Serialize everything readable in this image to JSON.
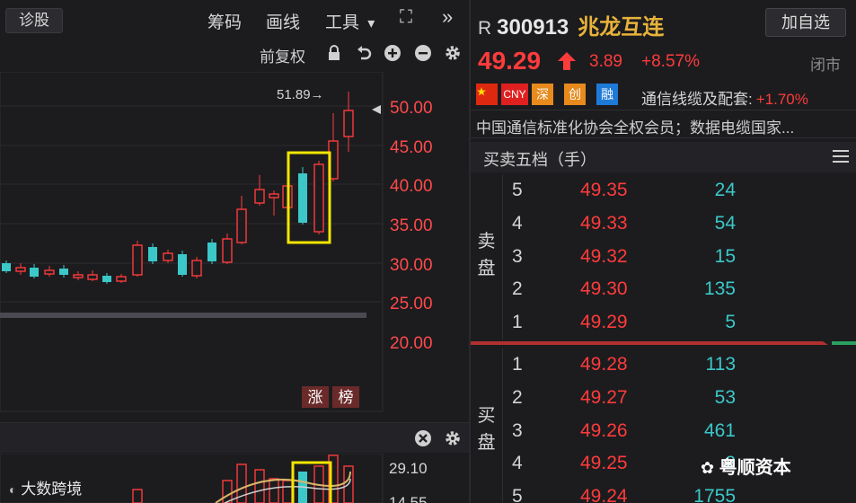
{
  "toolbar": {
    "diag_label": "诊股",
    "chips_label": "筹码",
    "draw_label": "画线",
    "tools_label": "工具",
    "tools_arrow": "▾",
    "expand_glyph": "⛶",
    "more_glyph": "»",
    "adjust_label": "前复权"
  },
  "chart_main": {
    "price_ticks": [
      "50.00",
      "45.00",
      "40.00",
      "35.00",
      "30.00",
      "25.00",
      "20.00"
    ],
    "high_label": "51.89→",
    "badge1": "涨",
    "badge2": "榜"
  },
  "chart_vol": {
    "ticks": [
      "29.10",
      "14.55"
    ]
  },
  "stock": {
    "badge": "R",
    "code": "300913",
    "name": "兆龙互连",
    "add_label": "加自选",
    "price": "49.29",
    "change": "3.89",
    "change_pct": "+8.57%",
    "status": "闭市"
  },
  "tags": [
    "CNY",
    "深",
    "创",
    "融"
  ],
  "sector": {
    "name": "通信线缆及配套:",
    "change": "+1.70%"
  },
  "description": "中国通信标准化协会全权会员；数据电缆国家...",
  "orderbook": {
    "title": "买卖五档（手）",
    "sell_label": [
      "卖",
      "盘"
    ],
    "buy_label": [
      "买",
      "盘"
    ],
    "asks": [
      {
        "level": "5",
        "price": "49.35",
        "vol": "24"
      },
      {
        "level": "4",
        "price": "49.33",
        "vol": "54"
      },
      {
        "level": "3",
        "price": "49.32",
        "vol": "15"
      },
      {
        "level": "2",
        "price": "49.30",
        "vol": "135"
      },
      {
        "level": "1",
        "price": "49.29",
        "vol": "5"
      }
    ],
    "bids": [
      {
        "level": "1",
        "price": "49.28",
        "vol": "113"
      },
      {
        "level": "2",
        "price": "49.27",
        "vol": "53"
      },
      {
        "level": "3",
        "price": "49.26",
        "vol": "461"
      },
      {
        "level": "4",
        "price": "49.25",
        "vol": "2"
      },
      {
        "level": "5",
        "price": "49.24",
        "vol": "1755"
      }
    ]
  },
  "watermarks": {
    "left": "大数跨境",
    "right": "粤顺资本"
  },
  "colors": {
    "up": "#ff3b3b",
    "down": "#3cc8c8",
    "highlight": "#f2e600",
    "name": "#e8b23a"
  }
}
